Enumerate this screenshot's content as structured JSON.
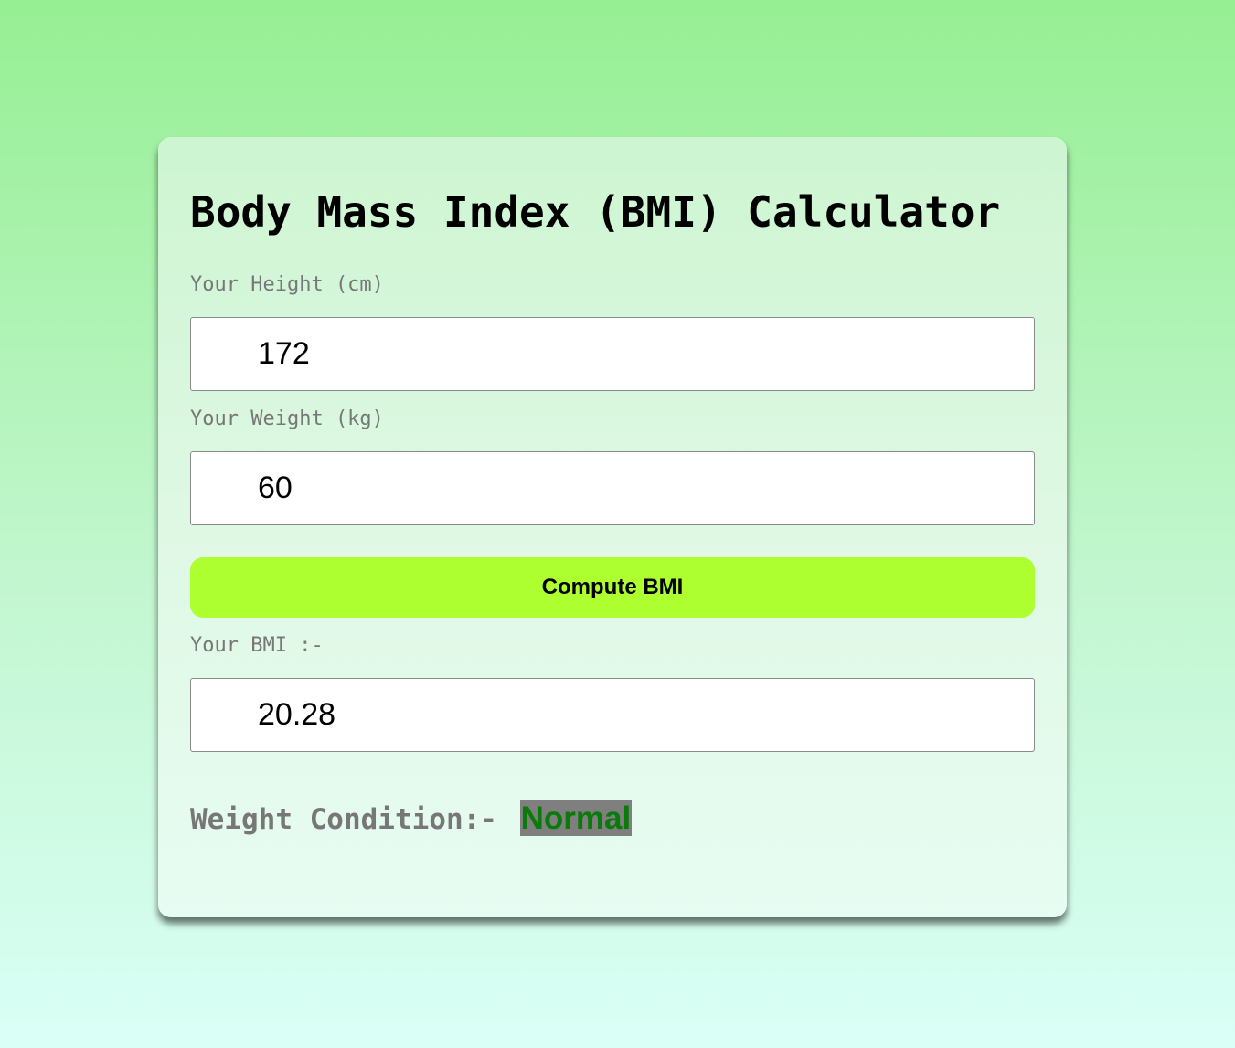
{
  "title": "Body Mass Index (BMI) Calculator",
  "height": {
    "label": "Your Height (cm)",
    "value": "172"
  },
  "weight": {
    "label": "Your Weight (kg)",
    "value": "60"
  },
  "compute_button": {
    "label": "Compute BMI"
  },
  "bmi": {
    "label": "Your BMI :-",
    "value": "20.28"
  },
  "condition": {
    "label": "Weight Condition:-",
    "value": "Normal"
  },
  "colors": {
    "button": "#adff2f",
    "condition_text": "#0a7a0a",
    "condition_highlight": "#7f7f7f"
  }
}
